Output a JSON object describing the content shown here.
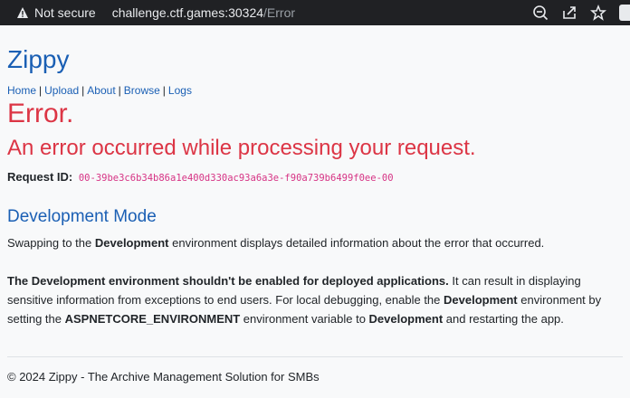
{
  "browser": {
    "security_label": "Not secure",
    "url_host": "challenge.ctf.games:30324",
    "url_path": "/Error"
  },
  "site": {
    "brand": "Zippy",
    "nav": [
      "Home",
      "Upload",
      "About",
      "Browse",
      "Logs"
    ]
  },
  "error": {
    "title": "Error.",
    "subtitle": "An error occurred while processing your request.",
    "request_id_label": "Request ID:",
    "request_id_value": "00-39be3c6b34b86a1e400d330ac93a6a3e-f90a739b6499f0ee-00"
  },
  "dev_mode": {
    "heading": "Development Mode",
    "p1": {
      "pre": "Swapping to the ",
      "bold": "Development",
      "post": " environment displays detailed information about the error that occurred."
    },
    "p2": {
      "bold1": "The Development environment shouldn't be enabled for deployed applications.",
      "t1": " It can result in displaying sensitive information from exceptions to end users. For local debugging, enable the ",
      "bold2": "Development",
      "t2": " environment by setting the ",
      "bold3": "ASPNETCORE_ENVIRONMENT",
      "t3": " environment variable to ",
      "bold4": "Development",
      "t4": " and restarting the app."
    }
  },
  "footer": {
    "text": "© 2024 Zippy - The Archive Management Solution for SMBs"
  },
  "colors": {
    "link": "#1a5fb4",
    "error": "#dc3545",
    "code": "#d63384"
  }
}
